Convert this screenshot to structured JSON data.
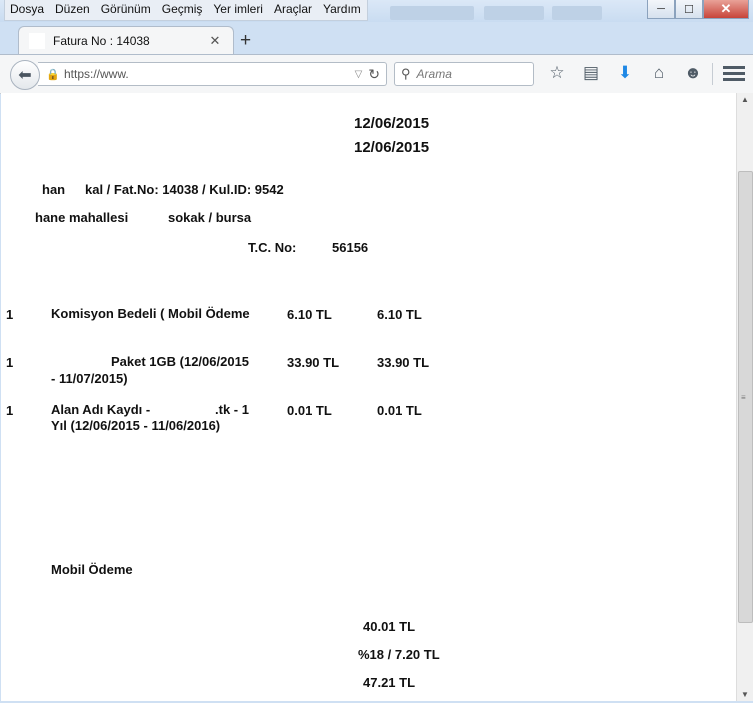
{
  "menu": [
    "Dosya",
    "Düzen",
    "Görünüm",
    "Geçmiş",
    "Yer imleri",
    "Araçlar",
    "Yardım"
  ],
  "window_controls": {
    "minimize": "─",
    "maximize": "☐",
    "close": "✕"
  },
  "tab": {
    "title": "Fatura No : 14038",
    "close": "✕",
    "new": "+"
  },
  "address": {
    "url": "https://www.",
    "search_placeholder": "Arama"
  },
  "invoice": {
    "date1": "12/06/2015",
    "date2": "12/06/2015",
    "customer_a": "han",
    "customer_b": "kal / Fat.No: 14038 / Kul.ID: 9542",
    "address_a": "hane mahallesi",
    "address_b": "sokak / bursa",
    "tc_label": "T.C. No:",
    "tc_value": "56156",
    "items": [
      {
        "qty": "1",
        "desc": "Komisyon Bedeli ( Mobil Ödeme",
        "desc2": "",
        "price": "6.10 TL",
        "total": "6.10 TL"
      },
      {
        "qty": "1",
        "desc": "Paket 1GB (12/06/2015",
        "desc2": "- 11/07/2015)",
        "price": "33.90 TL",
        "total": "33.90 TL"
      },
      {
        "qty": "1",
        "desc": "Alan Adı Kaydı -",
        "desc_b": ".tk - 1",
        "desc2": "Yıl (12/06/2015 - 11/06/2016)",
        "price": "0.01 TL",
        "total": "0.01 TL"
      }
    ],
    "payment_method": "Mobil Ödeme",
    "subtotal": "40.01 TL",
    "vat": "%18 / 7.20 TL",
    "grand_total": "47.21 TL"
  }
}
